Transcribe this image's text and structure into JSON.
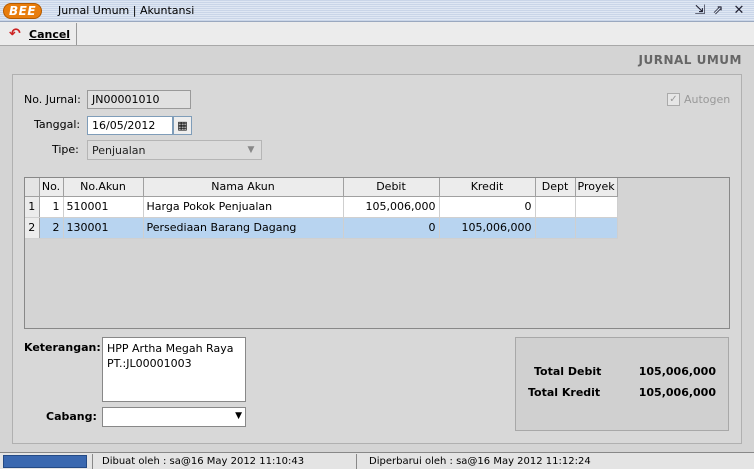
{
  "window": {
    "logo": "BEE",
    "title": "Jurnal Umum | Akuntansi",
    "restore_icon": "restore-icon",
    "maximize_icon": "maximize-icon",
    "close_icon": "close-icon"
  },
  "toolbar": {
    "cancel_label": "Cancel",
    "cancel_icon": "undo-icon"
  },
  "form": {
    "header": "JURNAL UMUM",
    "no_jurnal_label": "No. Jurnal:",
    "no_jurnal_value": "JN00001010",
    "tanggal_label": "Tanggal:",
    "tanggal_value": "16/05/2012",
    "tipe_label": "Tipe:",
    "tipe_value": "Penjualan",
    "autogen_label": "Autogen",
    "autogen_checked": true
  },
  "grid": {
    "columns": [
      "No.",
      "No.Akun",
      "Nama Akun",
      "Debit",
      "Kredit",
      "Dept",
      "Proyek"
    ],
    "rows": [
      {
        "rownum": "1",
        "no": "1",
        "akun": "510001",
        "nama": "Harga Pokok Penjualan",
        "debit": "105,006,000",
        "kredit": "0",
        "dept": "",
        "proyek": ""
      },
      {
        "rownum": "2",
        "no": "2",
        "akun": "130001",
        "nama": "Persediaan Barang Dagang",
        "debit": "0",
        "kredit": "105,006,000",
        "dept": "",
        "proyek": ""
      }
    ]
  },
  "bottom": {
    "keterangan_label": "Keterangan:",
    "keterangan_line1": "HPP Artha Megah Raya",
    "keterangan_line2": "PT.:JL00001003",
    "cabang_label": "Cabang:",
    "cabang_value": "",
    "total_debit_label": "Total Debit",
    "total_debit_value": "105,006,000",
    "total_kredit_label": "Total Kredit",
    "total_kredit_value": "105,006,000"
  },
  "status": {
    "dibuat": "Dibuat oleh : sa@16 May 2012  11:10:43",
    "diperbarui": "Diperbarui oleh : sa@16 May 2012  11:12:24"
  },
  "colors": {
    "accent": "#e87d0d",
    "selected_row": "#b8d4f0",
    "status_blue": "#3a68b0"
  }
}
